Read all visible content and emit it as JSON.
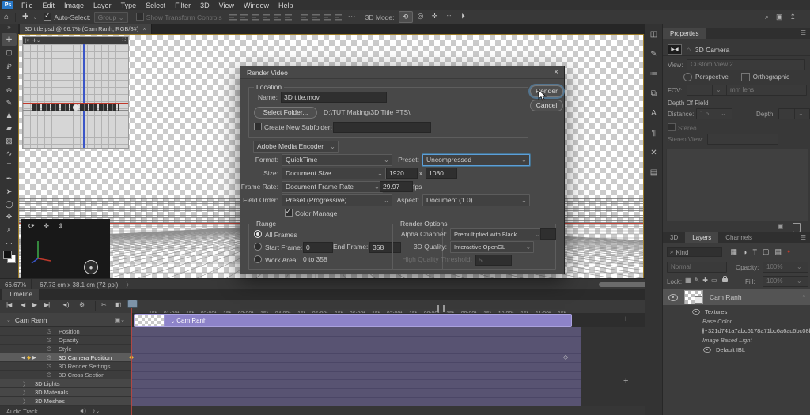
{
  "app": {
    "logo": "Ps"
  },
  "menu": {
    "items": [
      "File",
      "Edit",
      "Image",
      "Layer",
      "Type",
      "Select",
      "Filter",
      "3D",
      "View",
      "Window",
      "Help"
    ]
  },
  "icons": {
    "home": "⌂",
    "chevron_down": "⌄",
    "collapse_left": "»",
    "search": "⌕",
    "workspace": "▣",
    "share": "↥",
    "hamburger": "☰",
    "close": "×",
    "scissors": "✂",
    "gear": "⚙",
    "transition": "◧",
    "first_frame": "|◀",
    "prev_frame": "◀",
    "play": "▶",
    "next_frame": "▶|",
    "mute": "◄)",
    "plus": "+",
    "speaker": "◄)",
    "note": "♪⌄",
    "caret_open": "⌄",
    "caret_closed": "〉",
    "clip_toggle": "▣⌄",
    "collapse_up": "^",
    "ellipsis": "⋯",
    "kf_left": "◀",
    "kf_diamond": "◆",
    "kf_right": "▶",
    "orbit_widget": "⟳",
    "pan_widget": "✛",
    "dolly_widget": "⇕",
    "record": "●"
  },
  "options_bar": {
    "auto_select_label": "Auto-Select:",
    "group_label": "Group",
    "show_transform_label": "Show Transform Controls",
    "mode_label": "3D Mode:"
  },
  "mode_icons": [
    {
      "name": "orbit-3d-icon",
      "glyph": "⟲",
      "active": true
    },
    {
      "name": "roll-3d-icon",
      "glyph": "◎",
      "active": false
    },
    {
      "name": "pan-3d-icon",
      "glyph": "✛",
      "active": false
    },
    {
      "name": "slide-3d-icon",
      "glyph": "⁘",
      "active": false
    },
    {
      "name": "dolly-3d-icon",
      "glyph": "⏵",
      "active": false
    }
  ],
  "doc_tab": {
    "title": "3D title.psd @ 66.7% (Cam Ranh, RGB/8#)"
  },
  "tools": [
    {
      "name": "move-tool",
      "glyph": "✚",
      "active": true
    },
    {
      "name": "marquee-tool",
      "glyph": "▢",
      "active": false
    },
    {
      "name": "lasso-tool",
      "glyph": "℘",
      "active": false
    },
    {
      "name": "crop-tool",
      "glyph": "⌗",
      "active": false
    },
    {
      "name": "healing-brush-tool",
      "glyph": "⊕",
      "active": false
    },
    {
      "name": "brush-tool",
      "glyph": "✎",
      "active": false
    },
    {
      "name": "clone-stamp-tool",
      "glyph": "♟",
      "active": false
    },
    {
      "name": "eraser-tool",
      "glyph": "▰",
      "active": false
    },
    {
      "name": "gradient-tool",
      "glyph": "▧",
      "active": false
    },
    {
      "name": "smudge-tool",
      "glyph": "∿",
      "active": false
    },
    {
      "name": "type-tool",
      "glyph": "T",
      "active": false
    },
    {
      "name": "pen-tool",
      "glyph": "✒",
      "active": false
    },
    {
      "name": "path-select-tool",
      "glyph": "➤",
      "active": false
    },
    {
      "name": "shape-tool",
      "glyph": "◯",
      "active": false
    },
    {
      "name": "hand-tool",
      "glyph": "✥",
      "active": false
    },
    {
      "name": "zoom-tool",
      "glyph": "⌕",
      "active": false
    },
    {
      "name": "more-tools-icon",
      "glyph": "…",
      "active": false
    }
  ],
  "dock_icons": [
    {
      "name": "histogram-panel-icon",
      "glyph": "◫"
    },
    {
      "name": "brush-settings-panel-icon",
      "glyph": "✎"
    },
    {
      "name": "adjustments-panel-icon",
      "glyph": "≔"
    },
    {
      "name": "clone-source-panel-icon",
      "glyph": "⧉"
    },
    {
      "name": "character-panel-icon",
      "glyph": "A"
    },
    {
      "name": "paragraph-panel-icon",
      "glyph": "¶"
    },
    {
      "name": "tool-presets-panel-icon",
      "glyph": "✕"
    },
    {
      "name": "libraries-panel-icon",
      "glyph": "▤"
    }
  ],
  "dialog": {
    "title": "Render Video",
    "location": {
      "legend": "Location",
      "name_label": "Name:",
      "name_value": "3D title.mov",
      "select_folder_label": "Select Folder...",
      "path": "D:\\TUT Making\\3D Title PTS\\",
      "subfolder_label": "Create New Subfolder:"
    },
    "encoder_value": "Adobe Media Encoder",
    "format_label": "Format:",
    "format_value": "QuickTime",
    "preset_label": "Preset:",
    "preset_value": "Uncompressed",
    "size_label": "Size:",
    "size_value": "Document Size",
    "width_value": "1920",
    "times_label": "x",
    "height_value": "1080",
    "frame_rate_label": "Frame Rate:",
    "frame_rate_value": "Document Frame Rate",
    "fps_value": "29.97",
    "fps_unit": "fps",
    "field_order_label": "Field Order:",
    "field_order_value": "Preset (Progressive)",
    "aspect_label": "Aspect:",
    "aspect_value": "Document (1.0)",
    "color_manage_label": "Color Manage",
    "range": {
      "legend": "Range",
      "all_frames_label": "All Frames",
      "start_label": "Start Frame:",
      "start_value": "0",
      "end_label": "End Frame:",
      "end_value": "358",
      "work_area_label": "Work Area:",
      "work_area_value": "0 to 358"
    },
    "render_options": {
      "legend": "Render Options",
      "alpha_label": "Alpha Channel:",
      "alpha_value": "Premultiplied with Black",
      "quality_label": "3D Quality:",
      "quality_value": "Interactive OpenGL",
      "threshold_label": "High Quality Threshold:",
      "threshold_value": "5"
    },
    "render_label": "Render",
    "cancel_label": "Cancel"
  },
  "status_bar": {
    "zoom_level": "66.67%",
    "doc_info": "67.73 cm x 38.1 cm (72 ppi)",
    "chevron": "〉"
  },
  "timeline": {
    "tab_label": "Timeline",
    "ruler_labels": [
      "15f",
      "01:00f",
      "15f",
      "02:00f",
      "15f",
      "03:00f",
      "15f",
      "04:00f",
      "15f",
      "05:00f",
      "15f",
      "06:00f",
      "15f",
      "07:00f",
      "15f",
      "08:00f",
      "15f",
      "09:00f",
      "15f",
      "10:00f",
      "15f",
      "11:00f",
      "15f"
    ],
    "group_name": "Cam Ranh",
    "clip_label": "Cam Ranh",
    "tracks": [
      {
        "label": "Position",
        "type": "prop"
      },
      {
        "label": "Opacity",
        "type": "prop"
      },
      {
        "label": "Style",
        "type": "prop"
      },
      {
        "label": "3D Camera Position",
        "type": "prop",
        "highlighted": true
      },
      {
        "label": "3D Render Settings",
        "type": "prop"
      },
      {
        "label": "3D Cross Section",
        "type": "prop"
      },
      {
        "label": "3D Lights",
        "type": "group"
      },
      {
        "label": "3D Materials",
        "type": "group"
      },
      {
        "label": "3D Meshes",
        "type": "group"
      }
    ],
    "audio_label": "Audio Track"
  },
  "properties": {
    "tab_label": "Properties",
    "header_label": "3D Camera",
    "view_label": "View:",
    "view_value": "Custom View 2",
    "perspective_label": "Perspective",
    "orthographic_label": "Orthographic",
    "fov_label": "FOV:",
    "fov_value": "",
    "lens_value": "mm lens",
    "dof_label": "Depth Of Field",
    "distance_label": "Distance:",
    "distance_value": "1.5",
    "depth_label": "Depth:",
    "depth_value": "",
    "stereo_label": "Stereo",
    "stereo_view_label": "Stereo View:"
  },
  "layers": {
    "tabs": [
      {
        "label": "3D",
        "active": false
      },
      {
        "label": "Layers",
        "active": true
      },
      {
        "label": "Channels",
        "active": false
      }
    ],
    "search_value": "Kind",
    "blend_value": "Normal",
    "opacity_label": "Opacity:",
    "opacity_value": "100%",
    "lock_label": "Lock:",
    "fill_label": "Fill:",
    "fill_value": "100%",
    "layer_name": "Cam Ranh",
    "children": [
      {
        "label": "Textures",
        "eye": true,
        "indent": 1,
        "italic": false
      },
      {
        "label": "Base Color",
        "eye": false,
        "indent": 2,
        "italic": true
      },
      {
        "label": "321d741a7abc6178a71bc6a6ac6bc08b",
        "eye": true,
        "indent": 2,
        "italic": false
      },
      {
        "label": "Image Based Light",
        "eye": false,
        "indent": 2,
        "italic": true
      },
      {
        "label": "Default IBL",
        "eye": true,
        "indent": 2,
        "italic": false
      }
    ]
  },
  "colors": {
    "accent_blue": "#5c9fd8",
    "clip_purple": "#8d83c9",
    "lane_purple": "#585372",
    "keyframe_yellow": "#e8b73a",
    "playhead_red": "#c0392b"
  }
}
